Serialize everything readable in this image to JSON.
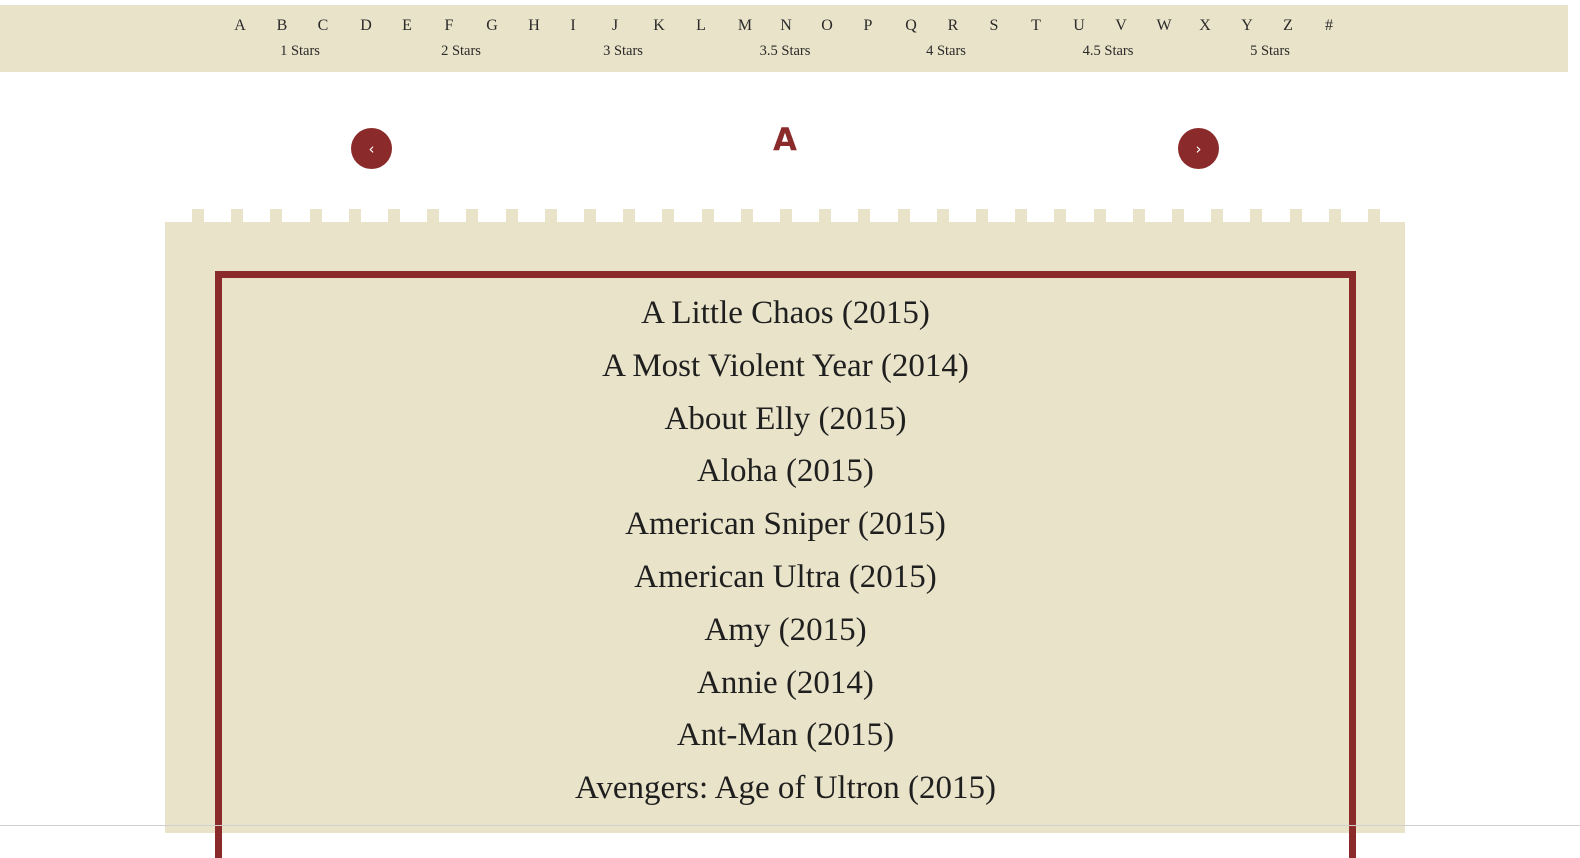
{
  "alphabet_nav": [
    "A",
    "B",
    "C",
    "D",
    "E",
    "F",
    "G",
    "H",
    "I",
    "J",
    "K",
    "L",
    "M",
    "N",
    "O",
    "P",
    "Q",
    "R",
    "S",
    "T",
    "U",
    "V",
    "W",
    "X",
    "Y",
    "Z",
    "#"
  ],
  "rating_nav": [
    "1 Stars",
    "2 Stars",
    "3 Stars",
    "3.5 Stars",
    "4 Stars",
    "4.5 Stars",
    "5 Stars"
  ],
  "pager": {
    "prev_label": "‹",
    "next_label": "›",
    "current": "A"
  },
  "movies": [
    "A Little Chaos (2015)",
    "A Most Violent Year (2014)",
    "About Elly (2015)",
    "Aloha (2015)",
    "American Sniper (2015)",
    "American Ultra (2015)",
    "Amy (2015)",
    "Annie (2014)",
    "Ant-Man (2015)",
    "Avengers: Age of Ultron (2015)"
  ],
  "colors": {
    "accent": "#8b2a2a",
    "paper": "#e8e3c9",
    "text": "#1f1f1f"
  }
}
